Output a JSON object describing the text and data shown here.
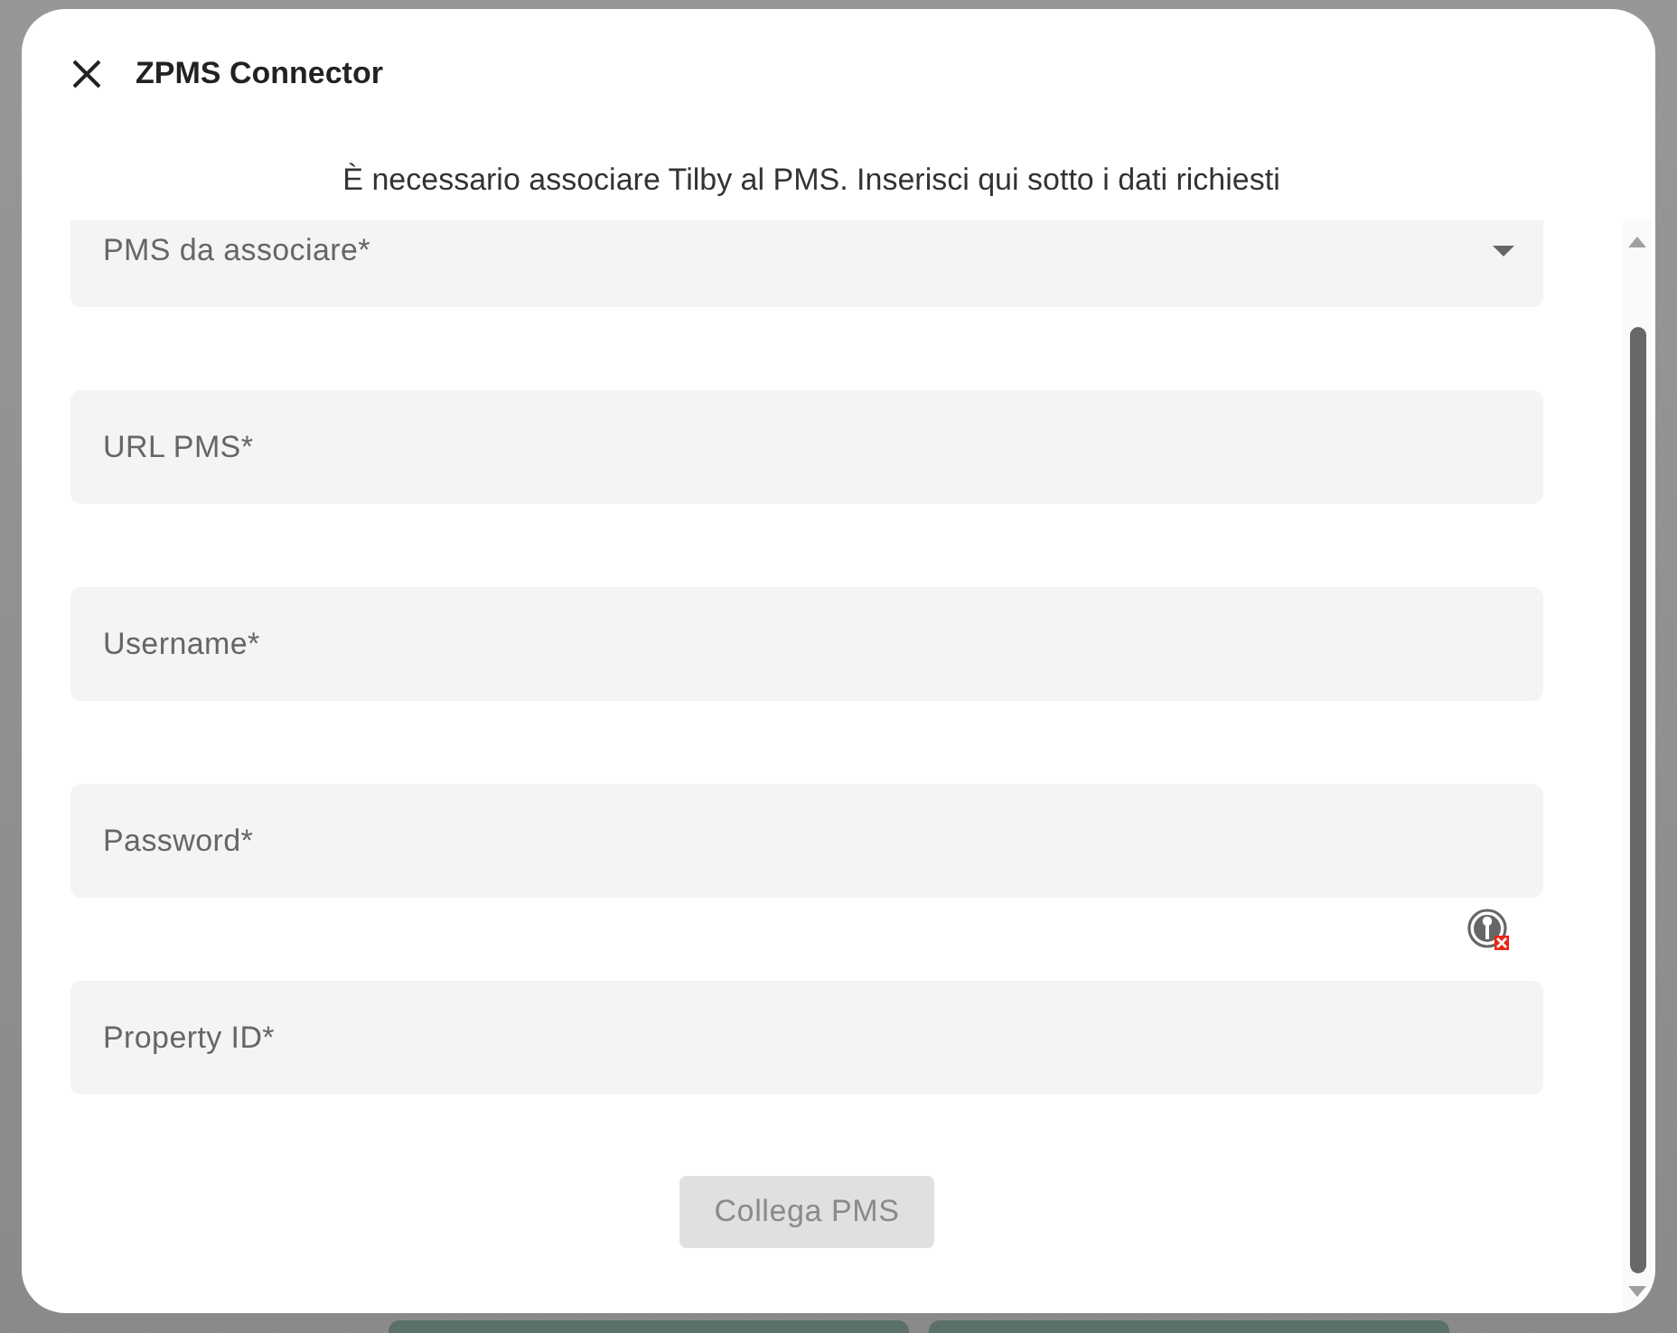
{
  "dialog": {
    "title": "ZPMS Connector",
    "message": "È necessario associare Tilby al PMS. Inserisci qui sotto i dati richiesti",
    "fields": [
      {
        "kind": "select",
        "label": "PMS da associare*"
      },
      {
        "kind": "text",
        "label": "URL PMS*"
      },
      {
        "kind": "text",
        "label": "Username*"
      },
      {
        "kind": "password",
        "label": "Password*"
      },
      {
        "kind": "text",
        "label": "Property ID*"
      }
    ],
    "button": {
      "label": "Collega PMS",
      "disabled": true
    }
  }
}
